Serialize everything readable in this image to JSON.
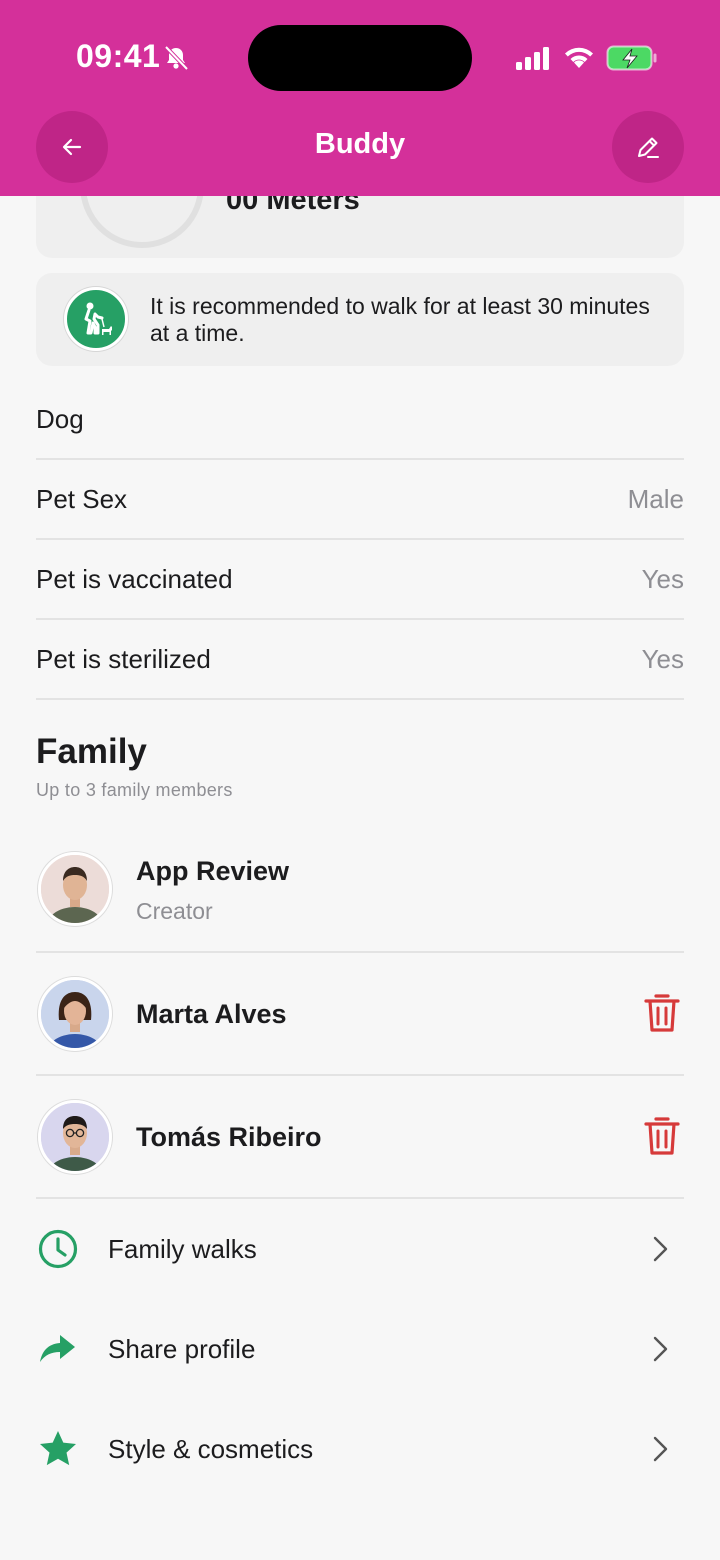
{
  "status_bar": {
    "time": "09:41"
  },
  "header": {
    "title": "Buddy"
  },
  "stats": {
    "distance": "00 Meters"
  },
  "tip": {
    "text": "It is recommended to walk for at least 30 minutes at a time."
  },
  "details": {
    "species": "Dog",
    "sex_label": "Pet Sex",
    "sex_value": "Male",
    "vaccinated_label": "Pet is vaccinated",
    "vaccinated_value": "Yes",
    "sterilized_label": "Pet is sterilized",
    "sterilized_value": "Yes"
  },
  "family": {
    "title": "Family",
    "subtitle": "Up to 3 family members",
    "members": [
      {
        "name": "App Review",
        "role": "Creator"
      },
      {
        "name": "Marta Alves"
      },
      {
        "name": "Tomás Ribeiro"
      }
    ]
  },
  "menu": {
    "items": [
      {
        "label": "Family walks",
        "icon": "clock-icon"
      },
      {
        "label": "Share profile",
        "icon": "share-arrow-icon"
      },
      {
        "label": "Style & cosmetics",
        "icon": "star-icon"
      }
    ]
  },
  "colors": {
    "header": "#d4309a",
    "accent_green": "#26a065",
    "delete_red": "#d63a3a",
    "background": "#f7f7f7"
  }
}
